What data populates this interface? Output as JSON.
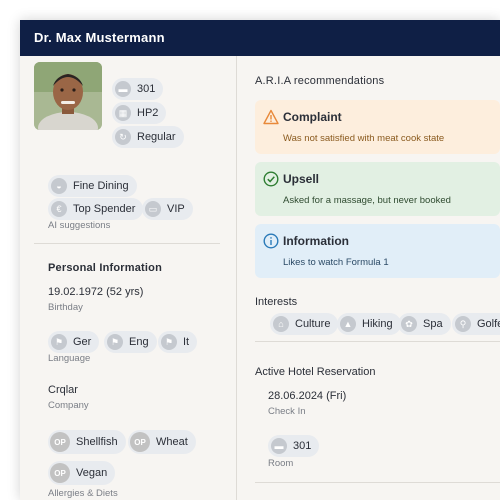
{
  "window": {
    "title": "Dr. Max Mustermann"
  },
  "profile": {
    "room_number": "301",
    "level": "HP2",
    "guest_type": "Regular"
  },
  "ai_suggestions": {
    "chips": [
      "Fine Dining",
      "Top Spender",
      "VIP"
    ],
    "label": "AI suggestions"
  },
  "personal": {
    "title": "Personal Information",
    "birthday_value": "19.02.1972 (52 yrs)",
    "birthday_label": "Birthday",
    "languages": [
      "Ger",
      "Eng",
      "It"
    ],
    "language_label": "Language",
    "company_value": "Crqlar",
    "company_label": "Company",
    "allergies": [
      {
        "badge": "OP",
        "label": "Shellfish"
      },
      {
        "badge": "OP",
        "label": "Wheat"
      },
      {
        "badge": "OP",
        "label": "Vegan"
      }
    ],
    "allergies_label": "Allergies & Diets"
  },
  "aria": {
    "title": "A.R.I.A recommendations",
    "cards": [
      {
        "title": "Complaint",
        "text": "Was not satisfied with meat cook state",
        "bg": "#fdeedd",
        "accent": "#e8893a"
      },
      {
        "title": "Upsell",
        "text": "Asked for a massage, but never booked",
        "bg": "#e2f0e3",
        "accent": "#2e7d32"
      },
      {
        "title": "Information",
        "text": "Likes to watch Formula 1",
        "bg": "#e1eef8",
        "accent": "#2a7ab8"
      }
    ]
  },
  "interests": {
    "title": "Interests",
    "items": [
      "Culture",
      "Hiking",
      "Spa",
      "Golfe"
    ]
  },
  "reservation": {
    "title": "Active Hotel Reservation",
    "checkin_value": "28.06.2024 (Fri)",
    "checkin_label": "Check In",
    "room_value": "301",
    "room_label": "Room"
  },
  "colors": {
    "titlebar": "#0f1f45",
    "chip_bg": "#e8ebef",
    "panel_bg": "#f7f5f2"
  }
}
